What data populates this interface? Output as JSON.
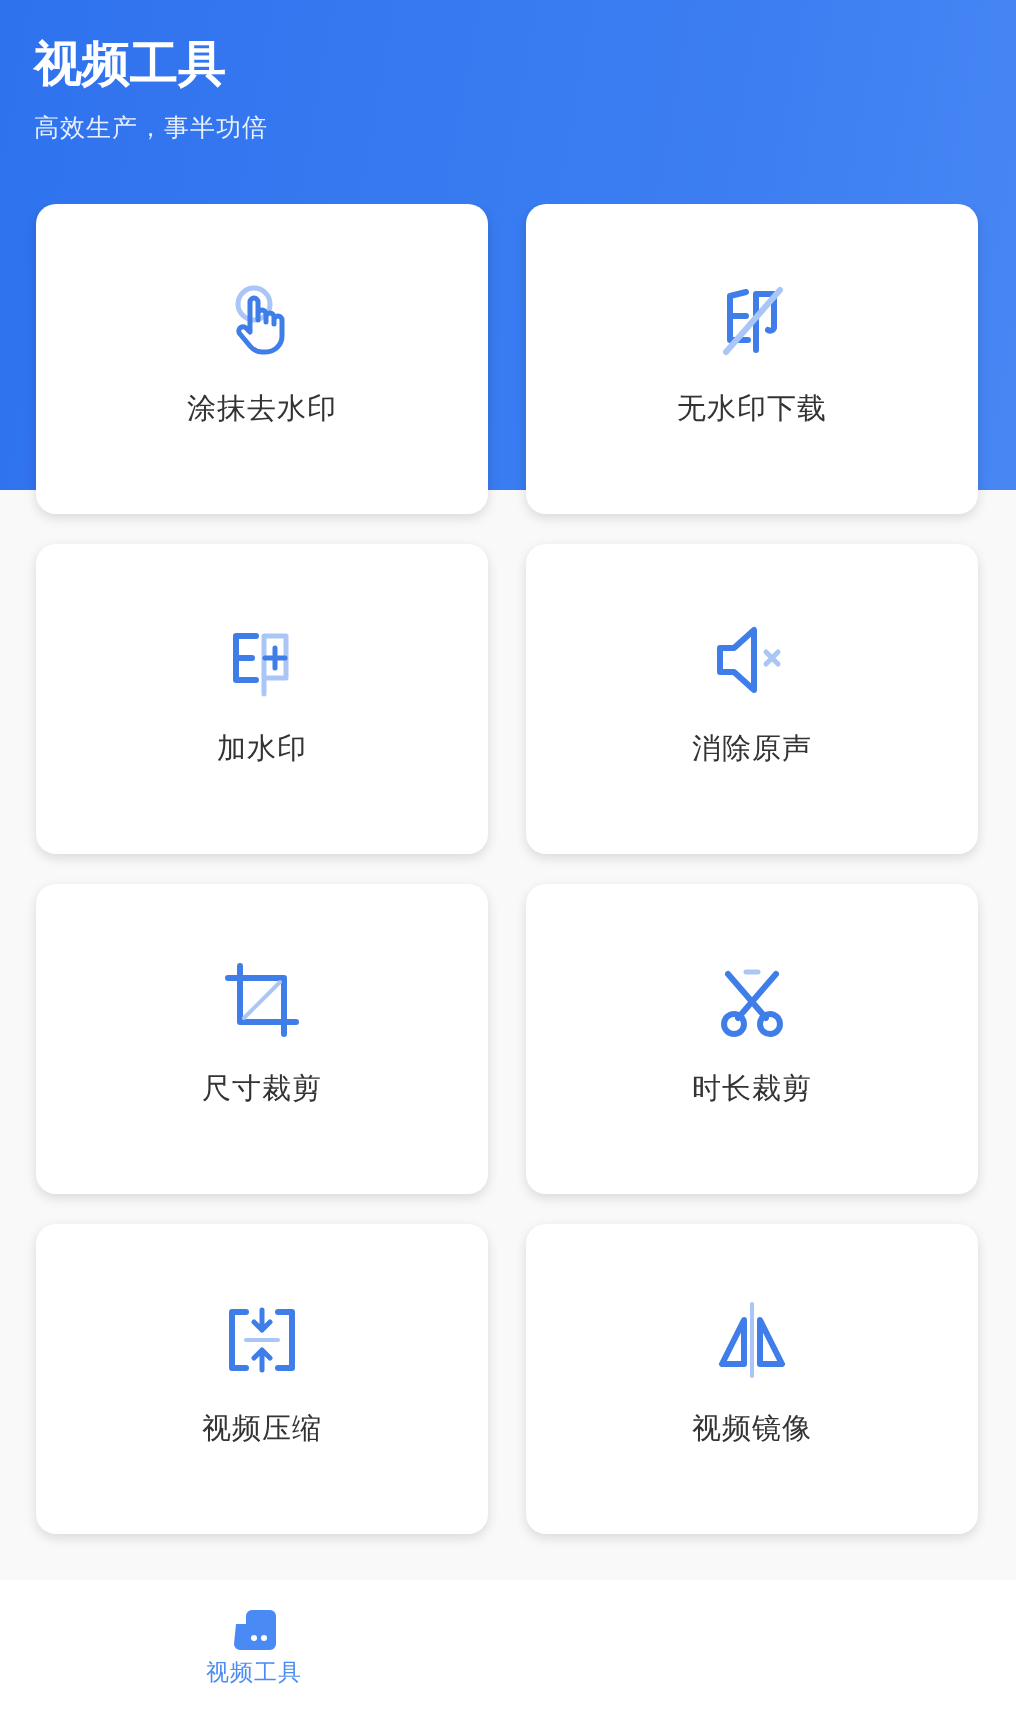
{
  "header": {
    "title": "视频工具",
    "subtitle": "高效生产，事半功倍"
  },
  "tools": [
    {
      "kind": "tap",
      "label": "涂抹去水印"
    },
    {
      "kind": "no-watermark",
      "label": "无水印下载"
    },
    {
      "kind": "add-watermark",
      "label": "加水印"
    },
    {
      "kind": "mute",
      "label": "消除原声"
    },
    {
      "kind": "crop",
      "label": "尺寸裁剪"
    },
    {
      "kind": "trim",
      "label": "时长裁剪"
    },
    {
      "kind": "compress",
      "label": "视频压缩"
    },
    {
      "kind": "mirror",
      "label": "视频镜像"
    }
  ],
  "bottom_nav": [
    {
      "label": "视频工具",
      "selected": true
    }
  ]
}
